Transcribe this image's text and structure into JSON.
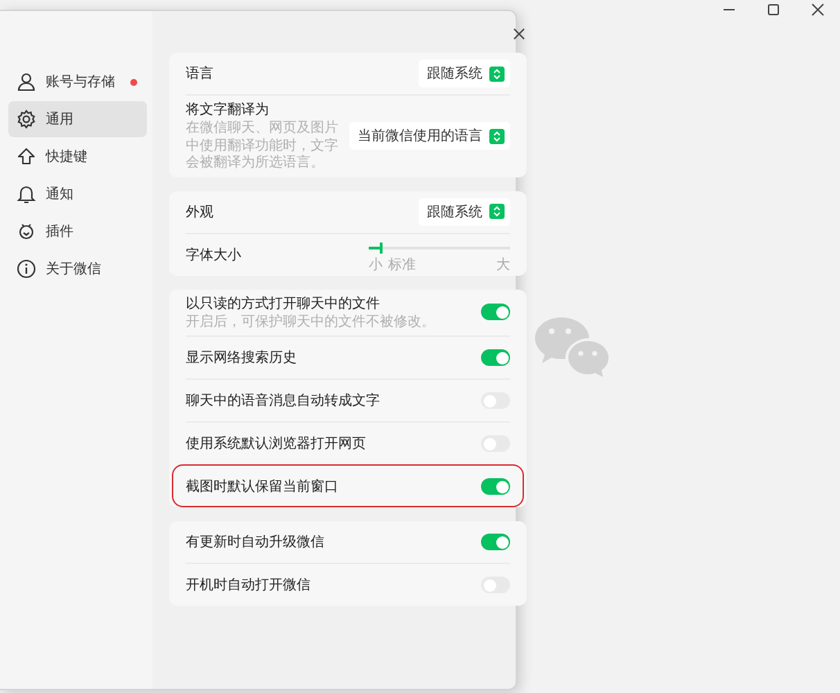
{
  "sidebar": {
    "items": [
      {
        "label": "账号与存储",
        "kind": "person",
        "selected": false,
        "badge": true
      },
      {
        "label": "通用",
        "kind": "gear",
        "selected": true,
        "badge": false
      },
      {
        "label": "快捷键",
        "kind": "shortcut",
        "selected": false,
        "badge": false
      },
      {
        "label": "通知",
        "kind": "notification",
        "selected": false,
        "badge": false
      },
      {
        "label": "插件",
        "kind": "plugin",
        "selected": false,
        "badge": false
      },
      {
        "label": "关于微信",
        "kind": "about",
        "selected": false,
        "badge": false
      }
    ]
  },
  "cards": [
    {
      "rows": [
        {
          "kind": "select",
          "label": "语言",
          "value": "跟随系统"
        },
        {
          "kind": "select",
          "label": "将文字翻译为",
          "description": "在微信聊天、网页及图片中使用翻译功能时，文字会被翻译为所选语言。",
          "value": "当前微信使用的语言"
        }
      ]
    },
    {
      "rows": [
        {
          "kind": "select",
          "label": "外观",
          "value": "跟随系统"
        },
        {
          "kind": "slider",
          "label": "字体大小",
          "level": 0.08,
          "min_label": "小",
          "mid_label": "标准",
          "max_label": "大"
        }
      ]
    },
    {
      "rows": [
        {
          "kind": "toggle",
          "label": "以只读的方式打开聊天中的文件",
          "description": "开启后，可保护聊天中的文件不被修改。",
          "on": true,
          "highlighted": false
        },
        {
          "kind": "toggle",
          "label": "显示网络搜索历史",
          "on": true,
          "highlighted": false
        },
        {
          "kind": "toggle",
          "label": "聊天中的语音消息自动转成文字",
          "on": false,
          "highlighted": false
        },
        {
          "kind": "toggle",
          "label": "使用系统默认浏览器打开网页",
          "on": false,
          "highlighted": false
        },
        {
          "kind": "toggle",
          "label": "截图时默认保留当前窗口",
          "on": true,
          "highlighted": true
        }
      ]
    },
    {
      "rows": [
        {
          "kind": "toggle",
          "label": "有更新时自动升级微信",
          "on": true,
          "highlighted": false
        },
        {
          "kind": "toggle",
          "label": "开机时自动打开微信",
          "on": false,
          "highlighted": false
        }
      ]
    }
  ]
}
